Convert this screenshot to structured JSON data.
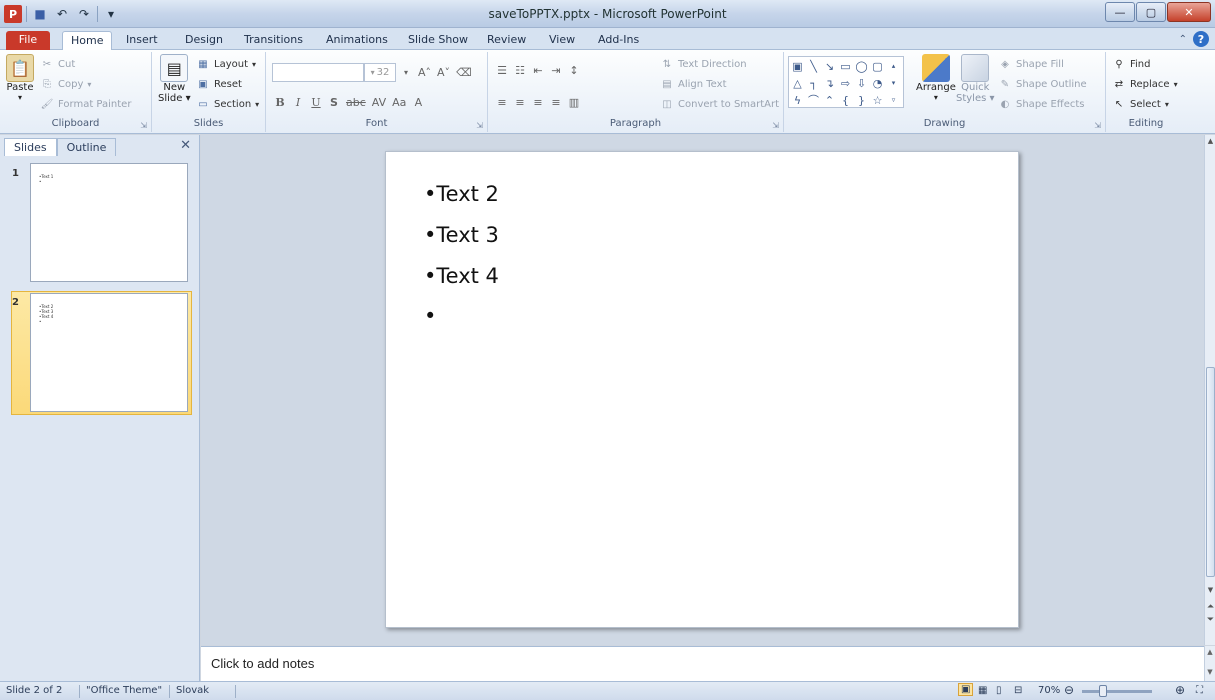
{
  "window": {
    "title": "saveToPPTX.pptx - Microsoft PowerPoint",
    "app_icon_letter": "P",
    "controls": {
      "minimize": "—",
      "maximize": "▢",
      "close": "✕"
    }
  },
  "quick_access": {
    "save": "💾",
    "undo": "↶",
    "redo": "↷",
    "customize": "▾"
  },
  "ribbon_tabs": {
    "file": "File",
    "items": [
      "Home",
      "Insert",
      "Design",
      "Transitions",
      "Animations",
      "Slide Show",
      "Review",
      "View",
      "Add-Ins"
    ],
    "active": "Home"
  },
  "clipboard": {
    "paste": "Paste",
    "cut": "Cut",
    "copy": "Copy",
    "format_painter": "Format Painter",
    "label": "Clipboard"
  },
  "slides_group": {
    "new_slide": "New",
    "new_slide_2": "Slide",
    "layout": "Layout",
    "reset": "Reset",
    "section": "Section",
    "label": "Slides"
  },
  "font_group": {
    "font_size": "32",
    "label": "Font"
  },
  "paragraph_group": {
    "text_direction": "Text Direction",
    "align_text": "Align Text",
    "convert_smartart": "Convert to SmartArt",
    "label": "Paragraph"
  },
  "drawing_group": {
    "arrange": "Arrange",
    "quick_styles": "Quick",
    "quick_styles_2": "Styles",
    "shape_fill": "Shape Fill",
    "shape_outline": "Shape Outline",
    "shape_effects": "Shape Effects",
    "label": "Drawing"
  },
  "editing_group": {
    "find": "Find",
    "replace": "Replace",
    "select": "Select",
    "label": "Editing"
  },
  "left_panel": {
    "tab_slides": "Slides",
    "tab_outline": "Outline",
    "close": "✕",
    "thumbnails": [
      {
        "number": "1",
        "lines": [
          "•Text 1",
          "•"
        ]
      },
      {
        "number": "2",
        "lines": [
          "•Text 2",
          "•Text 3",
          "•Text 4",
          "•"
        ]
      }
    ]
  },
  "slide": {
    "bullets": [
      "•Text 2",
      "•Text 3",
      "•Text 4",
      "•"
    ]
  },
  "notes": {
    "placeholder": "Click to add notes"
  },
  "status": {
    "slide_info": "Slide 2 of 2",
    "theme": "\"Office Theme\"",
    "language": "Slovak",
    "zoom": "70%",
    "zoom_level_percent": 70
  }
}
